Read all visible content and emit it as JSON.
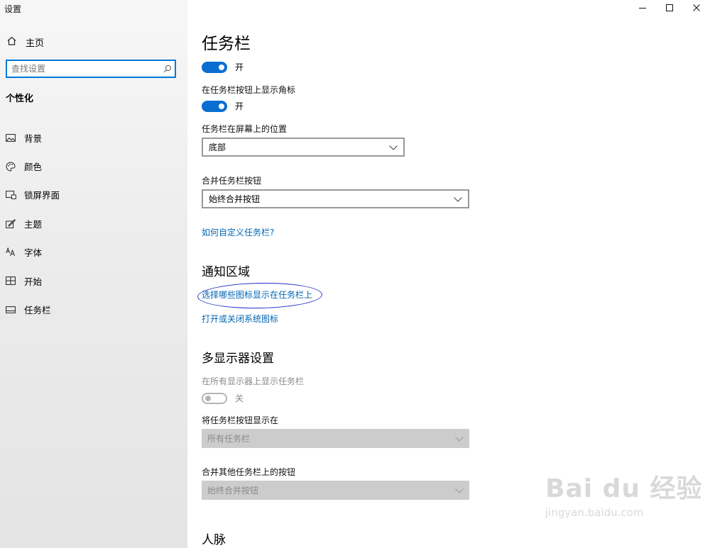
{
  "window": {
    "title": "设置",
    "controls": [
      "—",
      "☐",
      "✕"
    ]
  },
  "sidebar": {
    "home_label": "主页",
    "search_placeholder": "查找设置",
    "section_label": "个性化",
    "items": [
      {
        "label": "背景",
        "icon": "picture-icon"
      },
      {
        "label": "颜色",
        "icon": "palette-icon"
      },
      {
        "label": "锁屏界面",
        "icon": "lock-screen-icon"
      },
      {
        "label": "主题",
        "icon": "theme-brush-icon"
      },
      {
        "label": "字体",
        "icon": "font-icon"
      },
      {
        "label": "开始",
        "icon": "start-tiles-icon"
      },
      {
        "label": "任务栏",
        "icon": "taskbar-icon"
      }
    ]
  },
  "main": {
    "title": "任务栏",
    "toggle_top": {
      "state": "开",
      "on": true
    },
    "badge_label": "在任务栏按钮上显示角标",
    "badge_toggle": {
      "state": "开",
      "on": true
    },
    "position_label": "任务栏在屏幕上的位置",
    "position_value": "底部",
    "combine_label": "合并任务栏按钮",
    "combine_value": "始终合并按钮",
    "customize_link": "如何自定义任务栏?",
    "notification_heading": "通知区域",
    "notification_link1": "选择哪些图标显示在任务栏上",
    "notification_link2": "打开或关闭系统图标",
    "multi_heading": "多显示器设置",
    "multi_show_label": "在所有显示器上显示任务栏",
    "multi_toggle": {
      "state": "关",
      "on": false
    },
    "multi_buttons_label": "将任务栏按钮显示在",
    "multi_buttons_value": "所有任务栏",
    "multi_combine_label": "合并其他任务栏上的按钮",
    "multi_combine_value": "始终合并按钮",
    "people_heading": "人脉"
  },
  "watermark": {
    "logo_text": "Bai du 经验",
    "url": "jingyan.baidu.com"
  },
  "colors": {
    "accent": "#0a6ed1",
    "link": "#0066b4",
    "annotation_circle": "#2230c8"
  }
}
